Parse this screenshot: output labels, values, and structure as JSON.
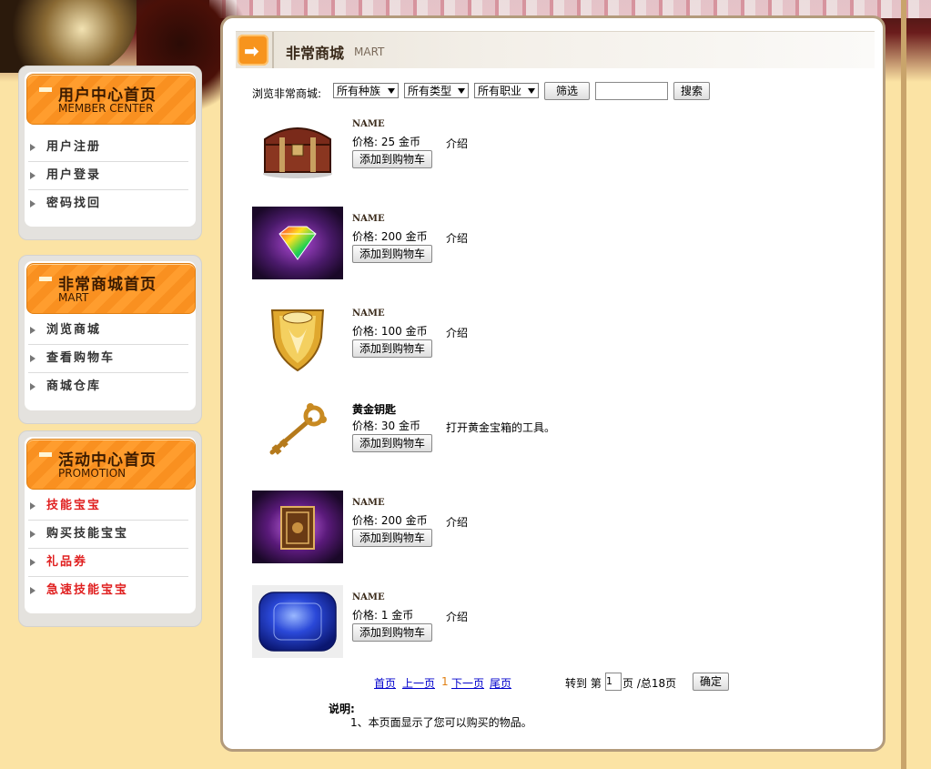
{
  "sidebar": {
    "member": {
      "title_cn": "用户中心首页",
      "title_en": "MEMBER CENTER",
      "items": [
        "用户注册",
        "用户登录",
        "密码找回"
      ]
    },
    "mart": {
      "title_cn": "非常商城首页",
      "title_en": "MART",
      "items": [
        "浏览商城",
        "查看购物车",
        "商城仓库"
      ]
    },
    "promotion": {
      "title_cn": "活动中心首页",
      "title_en": "PROMOTION",
      "items": [
        "技能宝宝",
        "购买技能宝宝",
        "礼品券",
        "急速技能宝宝"
      ]
    }
  },
  "header": {
    "title_cn": "非常商城",
    "title_en": "MART"
  },
  "filter": {
    "label": "浏览非常商城:",
    "race": "所有种族",
    "type": "所有类型",
    "job": "所有职业",
    "filter_btn": "筛选",
    "search_value": "",
    "search_btn": "搜索"
  },
  "items": [
    {
      "name": "NAME",
      "price": "价格: 25 金币",
      "desc": "介绍",
      "add": "添加到购物车"
    },
    {
      "name": "NAME",
      "price": "价格: 200 金币",
      "desc": "介绍",
      "add": "添加到购物车"
    },
    {
      "name": "NAME",
      "price": "价格: 100 金币",
      "desc": "介绍",
      "add": "添加到购物车"
    },
    {
      "name": "黄金钥匙",
      "price": "价格: 30 金币",
      "desc": "打开黄金宝箱的工具。",
      "add": "添加到购物车"
    },
    {
      "name": "NAME",
      "price": "价格: 200 金币",
      "desc": "介绍",
      "add": "添加到购物车"
    },
    {
      "name": "NAME",
      "price": "价格: 1 金币",
      "desc": "介绍",
      "add": "添加到购物车"
    }
  ],
  "pager": {
    "first": "首页",
    "prev": "上一页",
    "current": "1",
    "next": "下一页",
    "last": "尾页",
    "goto_prefix": "转到 第",
    "page_value": "1",
    "goto_suffix": "页 /总18页",
    "confirm": "确定"
  },
  "note": {
    "heading": "说明:",
    "line1": "1、本页面显示了您可以购买的物品。"
  },
  "colors": {
    "accent_orange": "#f7941d",
    "link_blue": "#0000cc",
    "promo_red": "#e02020"
  }
}
